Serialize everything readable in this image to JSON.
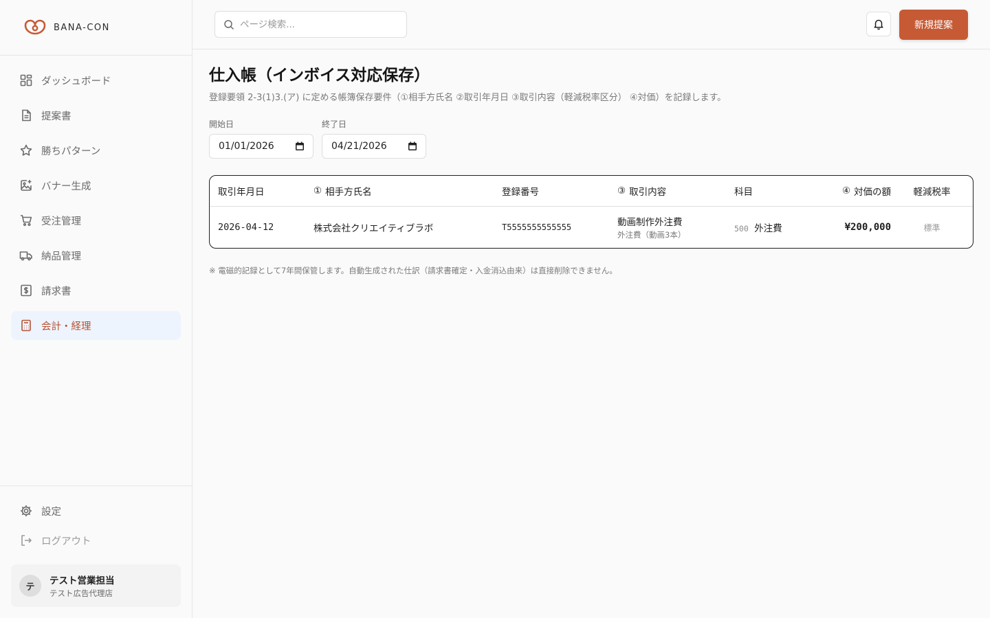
{
  "brand": {
    "name": "BANA-CON",
    "accent": "#c65a35"
  },
  "sidebar": {
    "items": [
      {
        "label": "ダッシュボード",
        "icon": "dashboard-icon"
      },
      {
        "label": "提案書",
        "icon": "document-icon"
      },
      {
        "label": "勝ちパターン",
        "icon": "star-icon"
      },
      {
        "label": "バナー生成",
        "icon": "image-plus-icon"
      },
      {
        "label": "受注管理",
        "icon": "cart-icon"
      },
      {
        "label": "納品管理",
        "icon": "truck-icon"
      },
      {
        "label": "請求書",
        "icon": "invoice-icon"
      },
      {
        "label": "会計・経理",
        "icon": "calculator-icon",
        "active": true
      }
    ],
    "settings_label": "設定",
    "logout_label": "ログアウト",
    "user": {
      "initial": "テ",
      "name": "テスト営業担当",
      "org": "テスト広告代理店"
    }
  },
  "topbar": {
    "search_placeholder": "ページ検索...",
    "new_button_label": "新規提案"
  },
  "page": {
    "title": "仕入帳（インボイス対応保存）",
    "subtitle": "登録要領 2-3(1)3.(ア) に定める帳簿保存要件（①相手方氏名 ②取引年月日 ③取引内容（軽減税率区分） ④対価）を記録します。",
    "filters": {
      "start_label": "開始日",
      "start_value": "01/01/2026",
      "end_label": "終了日",
      "end_value": "04/21/2026"
    },
    "table": {
      "headers": {
        "date": "取引年月日",
        "partner_marker": "①",
        "partner": "相手方氏名",
        "reg_no": "登録番号",
        "content_marker": "③",
        "content": "取引内容",
        "account": "科目",
        "amount_marker": "④",
        "amount": "対価の額",
        "tax": "軽減税率"
      },
      "rows": [
        {
          "date": "2026-04-12",
          "partner": "株式会社クリエイティブラボ",
          "reg_no": "T5555555555555",
          "content": "動画制作外注費",
          "content_sub": "外注費（動画3本）",
          "account_code": "500",
          "account": "外注費",
          "amount": "¥200,000",
          "tax": "標準"
        }
      ]
    },
    "note": "※ 電磁的記録として7年間保管します。自動生成された仕訳（請求書確定・入金消込由来）は直接削除できません。"
  }
}
